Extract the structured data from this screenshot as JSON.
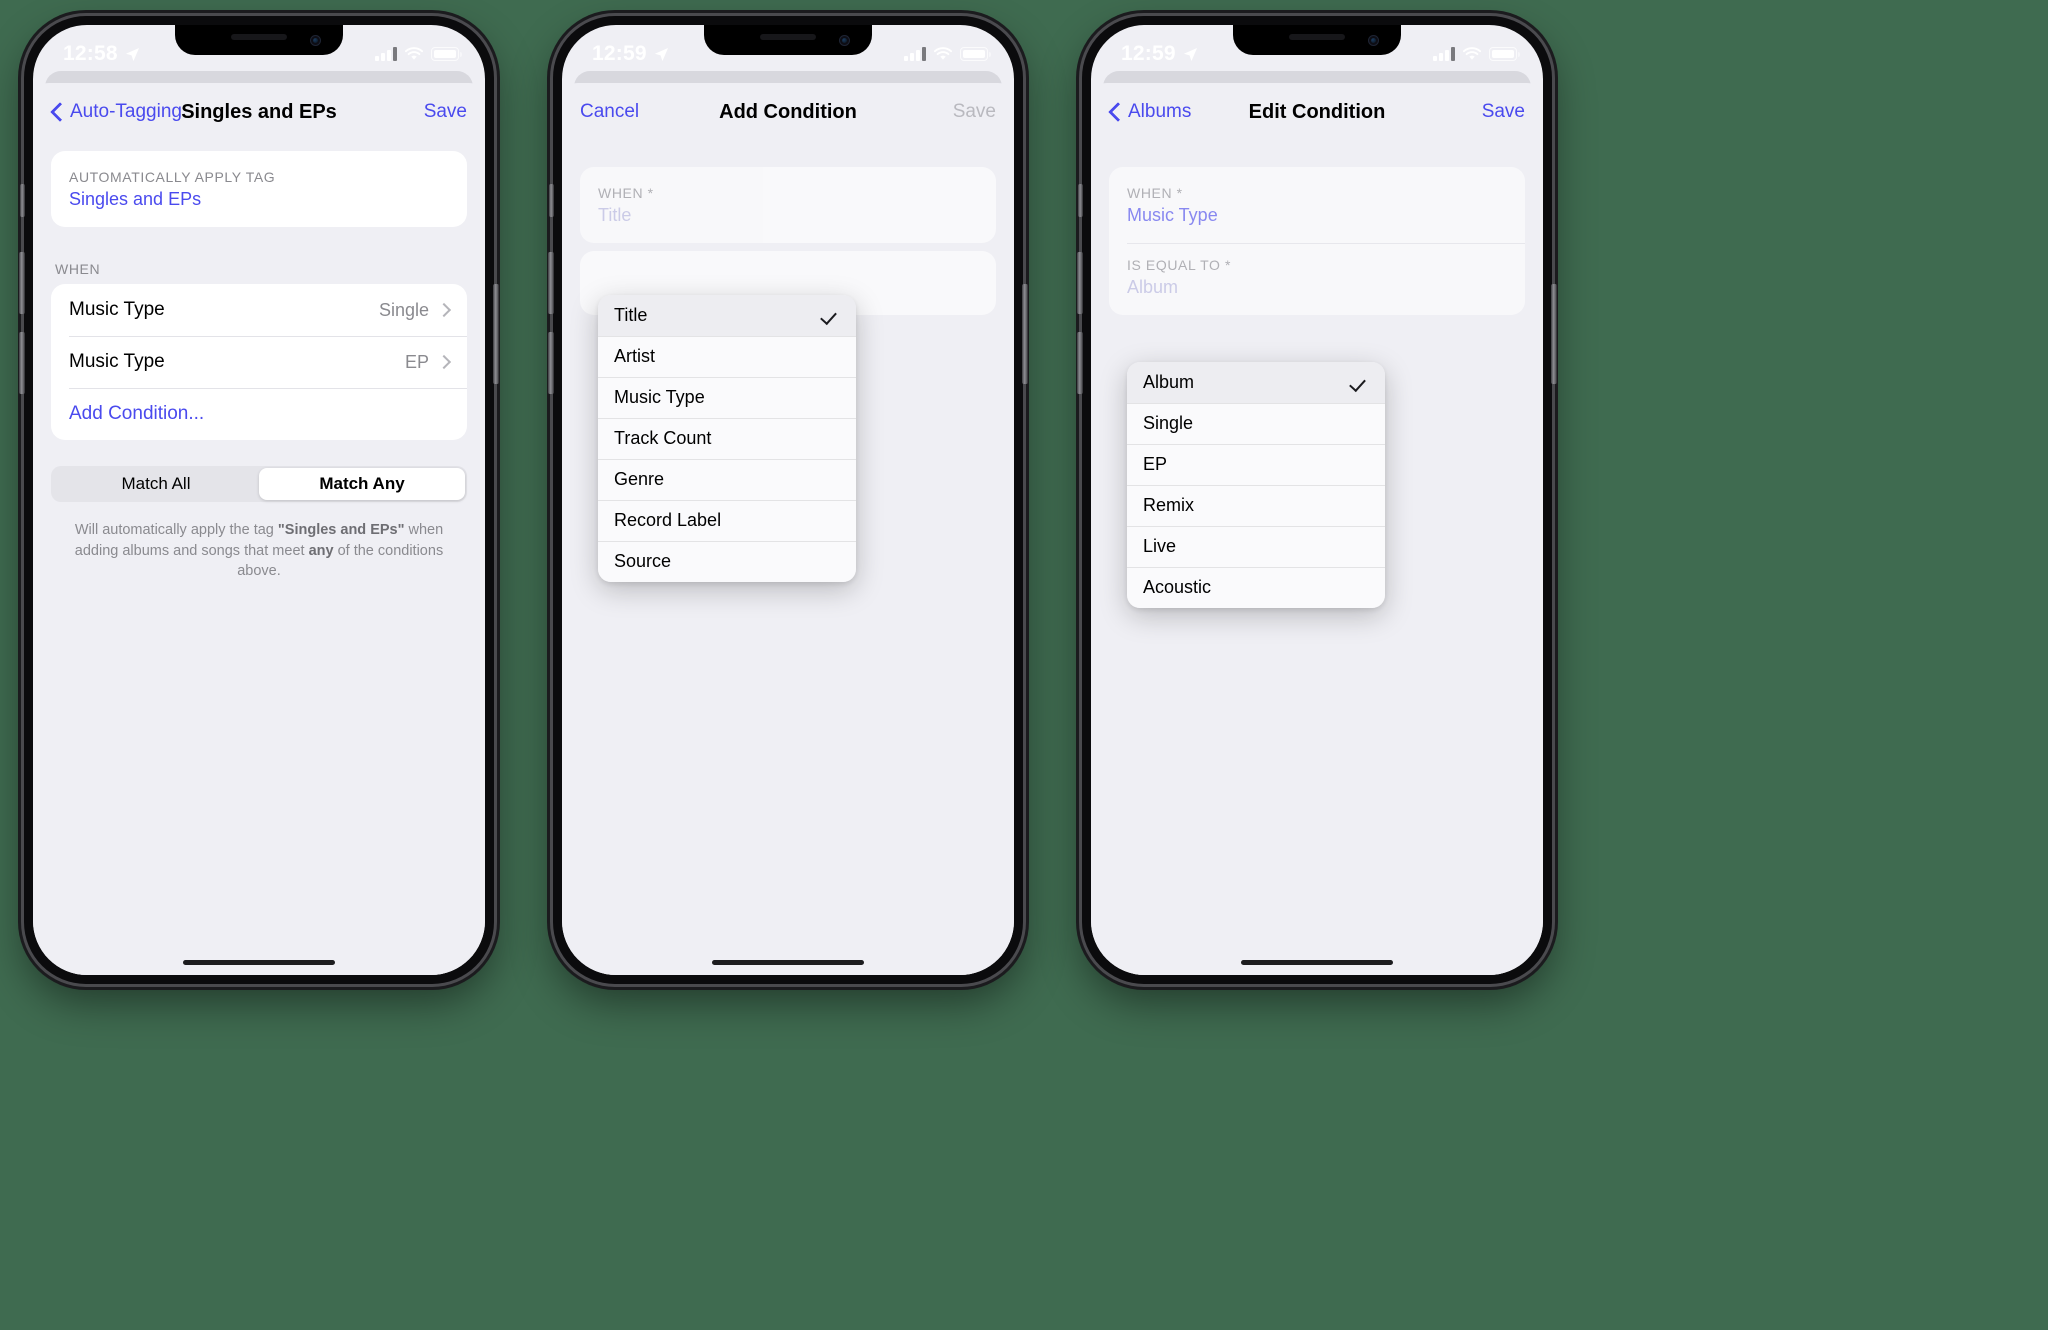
{
  "background_color": "#3f6b50",
  "accent_color": "#4a4aee",
  "phones": [
    {
      "status": {
        "time": "12:58",
        "location_icon": "location-arrow-icon",
        "battery_icon": "battery-icon",
        "wifi_icon": "wifi-icon",
        "cellular_icon": "cellular-signal-icon"
      },
      "nav": {
        "back_label": "Auto-Tagging",
        "title": "Singles and EPs",
        "action_label": "Save",
        "action_enabled": true
      },
      "apply_tag_section": {
        "header": "AUTOMATICALLY APPLY TAG",
        "value": "Singles and EPs"
      },
      "when_section": {
        "header": "WHEN",
        "rows": [
          {
            "label": "Music Type",
            "value": "Single",
            "accessory": "chevron-right-icon"
          },
          {
            "label": "Music Type",
            "value": "EP",
            "accessory": "chevron-right-icon"
          }
        ],
        "add_label": "Add Condition..."
      },
      "segmented": {
        "options": [
          "Match All",
          "Match Any"
        ],
        "selected_index": 1
      },
      "footnote": {
        "prefix": "Will automatically apply the tag ",
        "tag": "\"Singles and EPs\"",
        "middle": " when adding albums and songs that meet ",
        "emphasis": "any",
        "suffix": " of the conditions above."
      }
    },
    {
      "status": {
        "time": "12:59",
        "location_icon": "location-arrow-icon",
        "battery_icon": "battery-icon",
        "wifi_icon": "wifi-icon",
        "cellular_icon": "cellular-signal-icon"
      },
      "nav": {
        "back_label": "Cancel",
        "title": "Add Condition",
        "action_label": "Save",
        "action_enabled": false
      },
      "when_field": {
        "header": "WHEN *",
        "value": "Title",
        "is_placeholder": true
      },
      "popup": {
        "selected": "Title",
        "items": [
          {
            "label": "Title",
            "checked": true
          },
          {
            "label": "Artist",
            "checked": false
          },
          {
            "label": "Music Type",
            "checked": false
          },
          {
            "label": "Track Count",
            "checked": false
          },
          {
            "label": "Genre",
            "checked": false
          },
          {
            "label": "Record Label",
            "checked": false
          },
          {
            "label": "Source",
            "checked": false
          }
        ]
      }
    },
    {
      "status": {
        "time": "12:59",
        "location_icon": "location-arrow-icon",
        "battery_icon": "battery-icon",
        "wifi_icon": "wifi-icon",
        "cellular_icon": "cellular-signal-icon"
      },
      "nav": {
        "back_label": "Albums",
        "title": "Edit Condition",
        "action_label": "Save",
        "action_enabled": true
      },
      "when_field": {
        "header": "WHEN *",
        "value": "Music Type",
        "is_placeholder": false
      },
      "equal_field": {
        "header": "IS EQUAL TO *",
        "value": "Album",
        "is_placeholder": true
      },
      "popup": {
        "selected": "Album",
        "items": [
          {
            "label": "Album",
            "checked": true
          },
          {
            "label": "Single",
            "checked": false
          },
          {
            "label": "EP",
            "checked": false
          },
          {
            "label": "Remix",
            "checked": false
          },
          {
            "label": "Live",
            "checked": false
          },
          {
            "label": "Acoustic",
            "checked": false
          }
        ]
      }
    }
  ]
}
